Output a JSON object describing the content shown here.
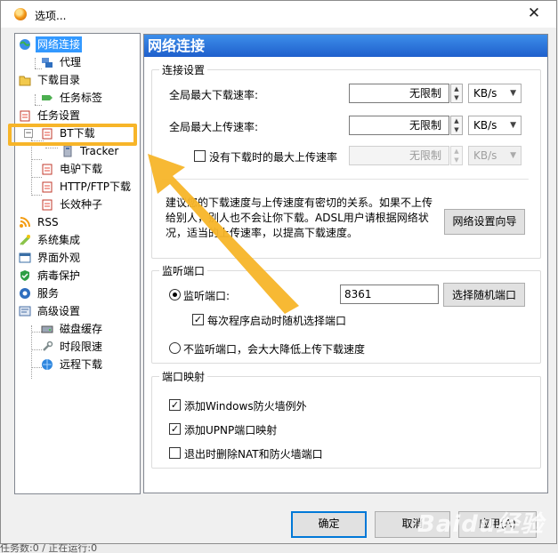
{
  "window": {
    "title": "选项..."
  },
  "tree": {
    "items": [
      {
        "label": "网络连接",
        "icon": "globe-icon"
      },
      {
        "label": "代理",
        "icon": "network-icon"
      },
      {
        "label": "下载目录",
        "icon": "folder-icon"
      },
      {
        "label": "任务标签",
        "icon": "tag-icon"
      },
      {
        "label": "任务设置",
        "icon": "clipboard-icon"
      },
      {
        "label": "BT下载",
        "icon": "clipboard-icon"
      },
      {
        "label": "Tracker",
        "icon": "server-icon"
      },
      {
        "label": "电驴下载",
        "icon": "clipboard-icon"
      },
      {
        "label": "HTTP/FTP下载",
        "icon": "clipboard-icon"
      },
      {
        "label": "长效种子",
        "icon": "clipboard-icon"
      },
      {
        "label": "RSS",
        "icon": "rss-icon"
      },
      {
        "label": "系统集成",
        "icon": "puzzle-icon"
      },
      {
        "label": "界面外观",
        "icon": "palette-icon"
      },
      {
        "label": "病毒保护",
        "icon": "shield-icon"
      },
      {
        "label": "服务",
        "icon": "service-icon"
      },
      {
        "label": "高级设置",
        "icon": "settings-icon"
      },
      {
        "label": "磁盘缓存",
        "icon": "disk-icon"
      },
      {
        "label": "时段限速",
        "icon": "wrench-icon"
      },
      {
        "label": "远程下载",
        "icon": "remote-globe-icon"
      }
    ]
  },
  "panel": {
    "header": "网络连接",
    "connection": {
      "group_title": "连接设置",
      "max_download_label": "全局最大下载速率:",
      "max_download_value": "无限制",
      "max_upload_label": "全局最大上传速率:",
      "max_upload_value": "无限制",
      "idle_upload_label": "没有下载时的最大上传速率",
      "idle_upload_value": "无限制",
      "unit": "KB/s",
      "info_text": "建议您的下载速度与上传速度有密切的关系。如果不上传给别人，别人也不会让你下载。ADSL用户请根据网络状况，适当的上传速率，以提高下载速度。",
      "wizard_button": "网络设置向导"
    },
    "listen": {
      "group_title": "监听端口",
      "listen_label": "监听端口:",
      "port_value": "8361",
      "random_button": "选择随机端口",
      "random_on_start_label": "每次程序启动时随机选择端口",
      "no_listen_label": "不监听端口，会大大降低上传下载速度"
    },
    "mapping": {
      "group_title": "端口映射",
      "firewall_label": "添加Windows防火墙例外",
      "upnp_label": "添加UPNP端口映射",
      "remove_label": "退出时删除NAT和防火墙端口"
    }
  },
  "footer": {
    "ok": "确定",
    "cancel": "取消",
    "apply": "应用(A)"
  },
  "watermark": "Baidu经验",
  "statusbar": "任务数:0 / 正在运行:0",
  "highlight_color": "#f7b529"
}
